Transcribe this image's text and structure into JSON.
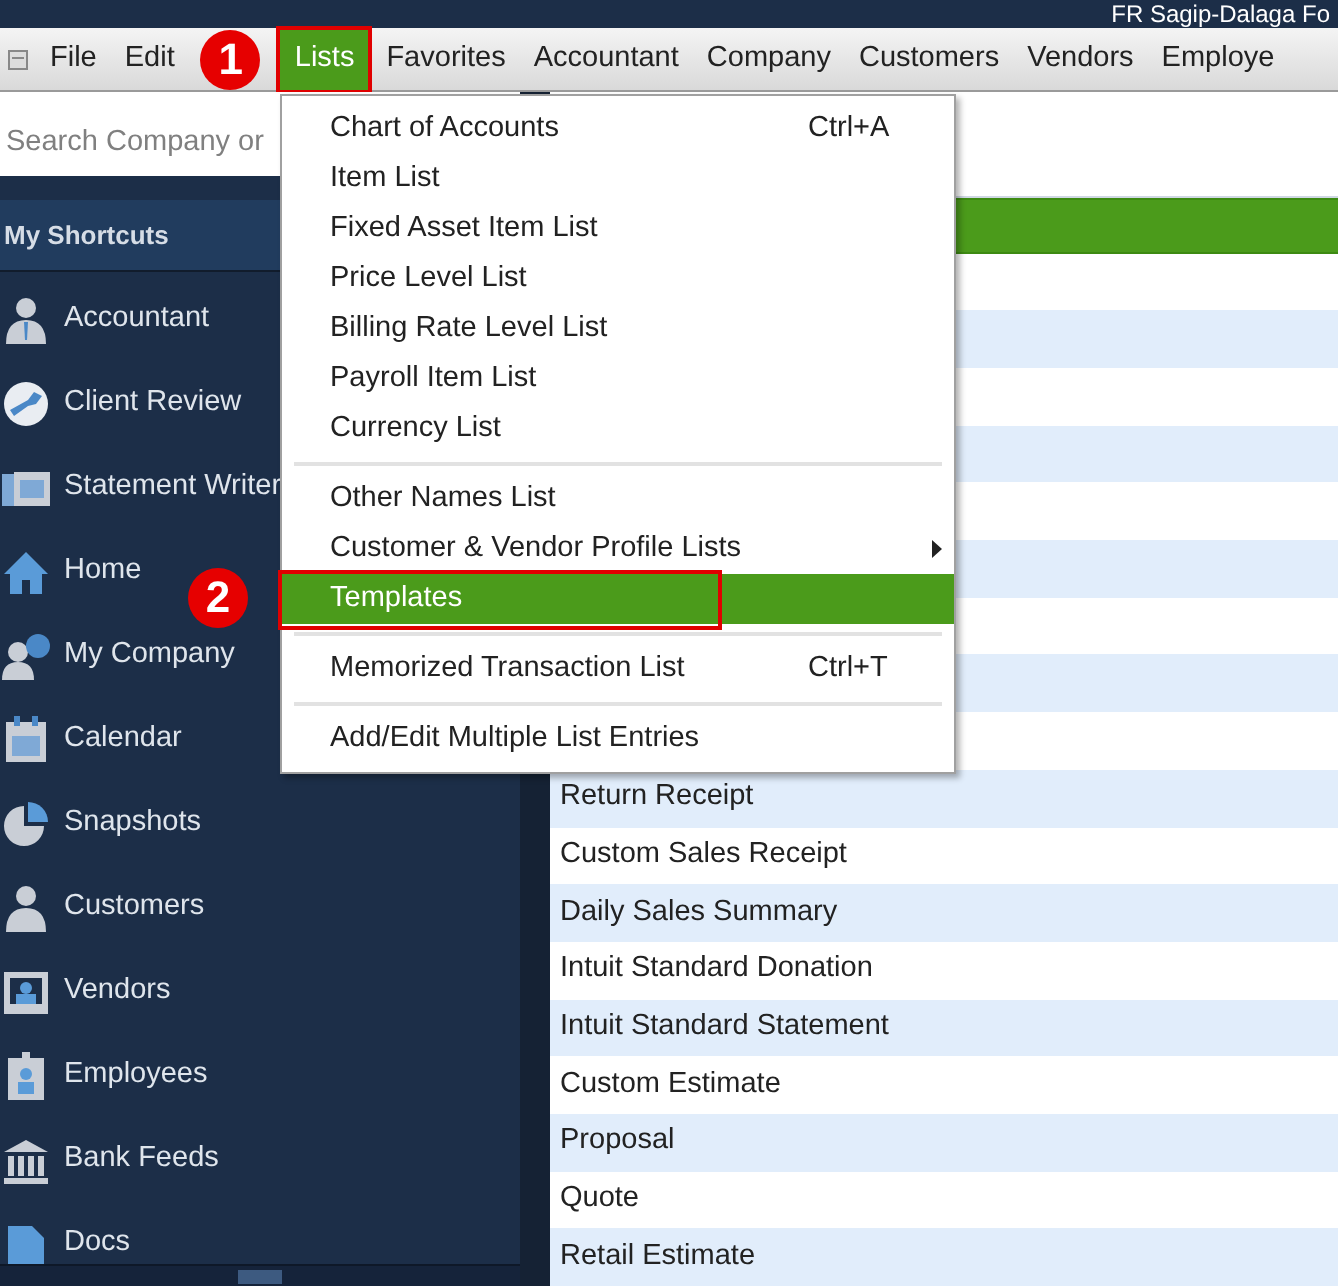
{
  "window": {
    "title": "FR Sagip-Dalaga Fo"
  },
  "menu_bar": [
    {
      "label": "File",
      "selected": false
    },
    {
      "label": "Edit",
      "selected": false
    },
    {
      "label": "Lists",
      "selected": true
    },
    {
      "label": "Favorites",
      "selected": false
    },
    {
      "label": "Accountant",
      "selected": false
    },
    {
      "label": "Company",
      "selected": false
    },
    {
      "label": "Customers",
      "selected": false
    },
    {
      "label": "Vendors",
      "selected": false
    },
    {
      "label": "Employe",
      "selected": false
    }
  ],
  "lists_menu": {
    "groups": [
      [
        {
          "label": "Chart of Accounts",
          "shortcut": "Ctrl+A",
          "selected": false
        },
        {
          "label": "Item List",
          "selected": false
        },
        {
          "label": "Fixed Asset Item List",
          "selected": false
        },
        {
          "label": "Price Level List",
          "selected": false
        },
        {
          "label": "Billing Rate Level List",
          "selected": false
        },
        {
          "label": "Payroll Item List",
          "selected": false
        },
        {
          "label": "Currency List",
          "selected": false
        }
      ],
      [
        {
          "label": "Other Names List",
          "selected": false
        },
        {
          "label": "Customer & Vendor Profile Lists",
          "submenu": true,
          "selected": false
        },
        {
          "label": "Templates",
          "selected": true
        }
      ],
      [
        {
          "label": "Memorized Transaction List",
          "shortcut": "Ctrl+T",
          "selected": false
        }
      ],
      [
        {
          "label": "Add/Edit Multiple List Entries",
          "selected": false
        }
      ]
    ]
  },
  "sidebar": {
    "search": {
      "placeholder": "Search Company or"
    },
    "header": "My Shortcuts",
    "items": [
      {
        "label": "Accountant"
      },
      {
        "label": "Client Review"
      },
      {
        "label": "Statement Writer"
      },
      {
        "label": "Home"
      },
      {
        "label": "My Company"
      },
      {
        "label": "Calendar"
      },
      {
        "label": "Snapshots"
      },
      {
        "label": "Customers"
      },
      {
        "label": "Vendors"
      },
      {
        "label": "Employees"
      },
      {
        "label": "Bank Feeds"
      },
      {
        "label": "Docs"
      }
    ]
  },
  "template_list": {
    "rows": [
      {
        "label": "Return Receipt"
      },
      {
        "label": "Custom Sales Receipt"
      },
      {
        "label": "Daily Sales Summary"
      },
      {
        "label": "Intuit Standard Donation"
      },
      {
        "label": "Intuit Standard Statement"
      },
      {
        "label": "Custom Estimate"
      },
      {
        "label": "Proposal"
      },
      {
        "label": "Quote"
      },
      {
        "label": "Retail Estimate"
      }
    ]
  },
  "annotations": [
    {
      "label": "1"
    },
    {
      "label": "2"
    }
  ]
}
